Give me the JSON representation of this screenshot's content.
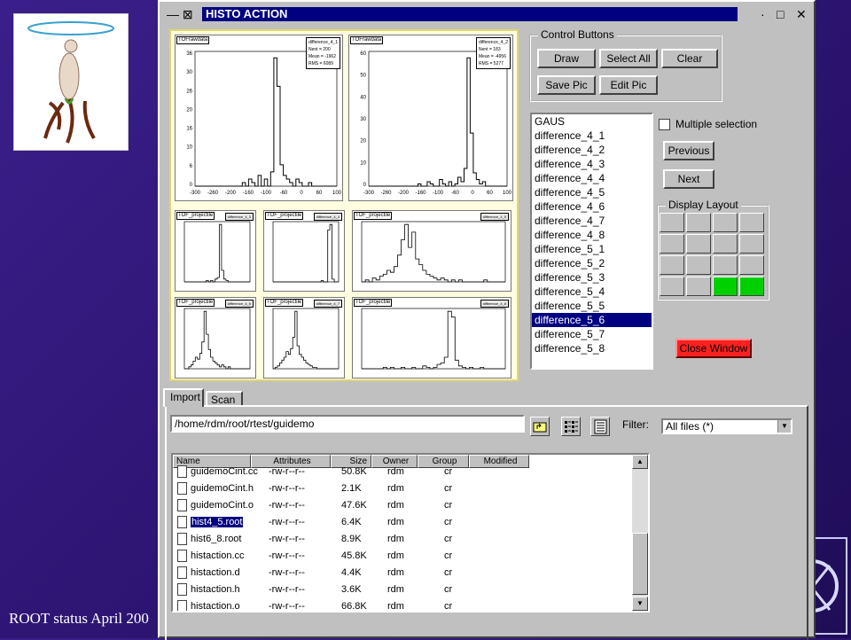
{
  "footer": {
    "text": "ROOT status April 200"
  },
  "window": {
    "title": "HISTO ACTION",
    "title_left_icons": "— ⊠",
    "min_glyph": "·",
    "max_glyph": "□",
    "close_glyph": "✕"
  },
  "canvas": {
    "pads": [
      {
        "tag": "TOFrawdata",
        "stats": [
          "difference_4_1",
          "Nent = 200",
          "Mean = -1962",
          "RMS = 6089"
        ],
        "xticks": [
          "-300",
          "-260",
          "-200",
          "-160",
          "-100",
          "-60",
          "0",
          "60",
          "100"
        ],
        "yticks": [
          "36",
          "30",
          "26",
          "20",
          "16",
          "10",
          "6",
          "0"
        ],
        "bins": [
          0,
          0,
          0,
          0,
          0,
          0,
          0,
          0,
          0,
          0,
          0,
          0,
          0,
          0,
          0,
          1,
          0,
          2,
          1,
          0,
          3,
          0,
          2,
          0,
          4,
          36,
          28,
          6,
          3,
          2,
          1,
          0,
          2,
          1,
          0,
          0,
          1,
          0,
          0,
          0,
          0,
          0,
          0,
          0,
          0
        ]
      },
      {
        "tag": "TOFrawdata",
        "stats": [
          "difference_4_2",
          "Nent = 183",
          "Mean = -4956",
          "RMS = 5277"
        ],
        "xticks": [
          "-300",
          "-260",
          "-200",
          "-160",
          "-100",
          "-60",
          "0",
          "60",
          "100"
        ],
        "yticks": [
          "60",
          "50",
          "40",
          "30",
          "20",
          "10",
          "0"
        ],
        "bins": [
          0,
          0,
          0,
          0,
          0,
          0,
          0,
          0,
          0,
          0,
          0,
          0,
          0,
          0,
          0,
          0,
          1,
          0,
          0,
          2,
          1,
          0,
          0,
          3,
          1,
          0,
          2,
          0,
          1,
          4,
          2,
          8,
          58,
          24,
          6,
          3,
          1,
          2,
          0,
          0,
          0,
          0,
          0,
          0,
          0
        ]
      },
      {
        "tag": "TOF_projectile",
        "stats": [
          "difference_4_3",
          ""
        ],
        "xticks": [],
        "yticks": [],
        "bins": [
          0,
          0,
          0,
          0,
          0,
          0,
          0,
          0,
          0,
          0,
          1,
          0,
          1,
          0,
          2,
          3,
          40,
          8,
          2,
          1,
          0,
          0,
          0,
          0,
          0,
          0,
          0,
          0,
          0,
          0
        ]
      },
      {
        "tag": "TOF_projectile",
        "stats": [
          "difference_4_4",
          ""
        ],
        "xticks": [],
        "yticks": [],
        "bins": [
          0,
          0,
          0,
          0,
          0,
          0,
          0,
          0,
          0,
          0,
          0,
          0,
          0,
          0,
          0,
          0,
          0,
          0,
          0,
          0,
          0,
          0,
          1,
          0,
          0,
          38,
          42,
          2,
          0,
          0
        ]
      },
      {
        "tag": "TOF_projectile",
        "stats": [
          "difference_4_5",
          ""
        ],
        "xticks": [],
        "yticks": [],
        "bins": [
          0,
          1,
          0,
          2,
          1,
          3,
          4,
          6,
          5,
          8,
          14,
          22,
          30,
          18,
          26,
          12,
          9,
          6,
          4,
          3,
          2,
          1,
          2,
          1,
          0,
          1,
          0,
          1,
          0,
          0,
          0,
          0,
          0,
          0,
          1,
          0,
          0,
          0,
          0,
          0
        ]
      },
      {
        "tag": "TOF_projectile",
        "stats": [
          "difference_4_6",
          ""
        ],
        "xticks": [],
        "yticks": [],
        "bins": [
          0,
          0,
          1,
          2,
          4,
          6,
          5,
          8,
          14,
          30,
          18,
          10,
          6,
          4,
          3,
          2,
          1,
          2,
          1,
          0,
          1,
          0,
          0,
          0,
          0,
          0,
          0,
          0,
          0,
          0
        ]
      },
      {
        "tag": "TOF_projectile",
        "stats": [
          "difference_4_7",
          ""
        ],
        "xticks": [],
        "yticks": [],
        "bins": [
          0,
          1,
          2,
          4,
          6,
          8,
          12,
          10,
          14,
          22,
          40,
          16,
          10,
          8,
          6,
          4,
          3,
          2,
          1,
          1,
          0,
          0,
          0,
          0,
          0,
          0,
          0,
          0,
          0,
          0
        ]
      },
      {
        "tag": "TOF_projectile",
        "stats": [
          "difference_4_8",
          ""
        ],
        "xticks": [],
        "yticks": [],
        "bins": [
          0,
          0,
          0,
          0,
          0,
          0,
          1,
          0,
          1,
          0,
          0,
          1,
          0,
          0,
          1,
          0,
          0,
          2,
          1,
          0,
          1,
          3,
          4,
          8,
          40,
          36,
          6,
          2,
          1,
          0,
          1,
          0,
          0,
          1,
          0,
          0,
          0,
          0,
          0,
          0
        ]
      }
    ]
  },
  "control_buttons": {
    "group_title": "Control Buttons",
    "draw": "Draw",
    "select_all": "Select All",
    "clear": "Clear",
    "save_pic": "Save Pic",
    "edit_pic": "Edit Pic"
  },
  "hist_list": {
    "items": [
      "GAUS",
      "difference_4_1",
      "difference_4_2",
      "difference_4_3",
      "difference_4_4",
      "difference_4_5",
      "difference_4_6",
      "difference_4_7",
      "difference_4_8",
      "difference_5_1",
      "difference_5_2",
      "difference_5_3",
      "difference_5_4",
      "difference_5_5",
      "difference_5_6",
      "difference_5_7",
      "difference_5_8"
    ],
    "selected_index": 14
  },
  "options": {
    "multiple_selection": "Multiple selection",
    "multiple_selection_checked": false,
    "previous": "Previous",
    "next": "Next",
    "display_layout": "Display Layout",
    "layout_active": [
      14,
      15
    ],
    "close_window": "Close Window"
  },
  "tabs": {
    "import": "Import",
    "scan": "Scan",
    "active": "Import"
  },
  "import": {
    "path": "/home/rdm/root/rtest/guidemo",
    "filter_label": "Filter:",
    "filter_value": "All files  (*)",
    "columns": [
      "Name",
      "Attributes",
      "Size",
      "Owner",
      "Group",
      "Modified"
    ],
    "files": [
      {
        "name": "guidemoCint.cc",
        "attr": "-rw-r--r--",
        "size": "50.8K",
        "owner": "rdm",
        "group": "cr"
      },
      {
        "name": "guidemoCint.h",
        "attr": "-rw-r--r--",
        "size": "2.1K",
        "owner": "rdm",
        "group": "cr"
      },
      {
        "name": "guidemoCint.o",
        "attr": "-rw-r--r--",
        "size": "47.6K",
        "owner": "rdm",
        "group": "cr"
      },
      {
        "name": "hist4_5.root",
        "attr": "-rw-r--r--",
        "size": "6.4K",
        "owner": "rdm",
        "group": "cr"
      },
      {
        "name": "hist6_8.root",
        "attr": "-rw-r--r--",
        "size": "8.9K",
        "owner": "rdm",
        "group": "cr"
      },
      {
        "name": "histaction.cc",
        "attr": "-rw-r--r--",
        "size": "45.8K",
        "owner": "rdm",
        "group": "cr"
      },
      {
        "name": "histaction.d",
        "attr": "-rw-r--r--",
        "size": "4.4K",
        "owner": "rdm",
        "group": "cr"
      },
      {
        "name": "histaction.h",
        "attr": "-rw-r--r--",
        "size": "3.6K",
        "owner": "rdm",
        "group": "cr"
      },
      {
        "name": "histaction.o",
        "attr": "-rw-r--r--",
        "size": "66.8K",
        "owner": "rdm",
        "group": "cr"
      }
    ],
    "selected_file_index": 3
  }
}
